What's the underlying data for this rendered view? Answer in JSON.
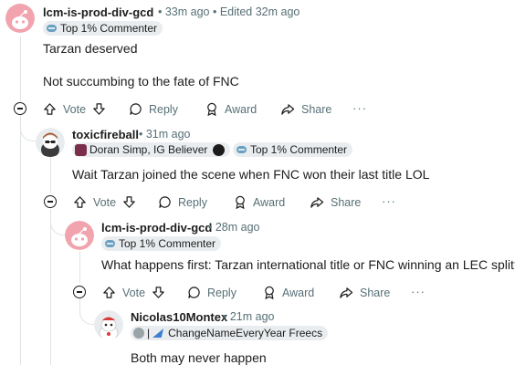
{
  "comments": [
    {
      "username": "lcm-is-prod-div-gcd",
      "meta": "• 33m ago • Edited 32m ago",
      "flair": "Top 1% Commenter",
      "body_line1": "Tarzan deserved",
      "body_line2": "Not succumbing to the fate of FNC"
    },
    {
      "username": "toxicfireball",
      "meta": "• 31m ago",
      "flair_user": "Doran Simp, IG Believer",
      "flair": "Top 1% Commenter",
      "body_line1": "Wait Tarzan joined the scene when FNC won their last title LOL"
    },
    {
      "username": "lcm-is-prod-div-gcd",
      "meta": "• 28m ago",
      "flair": "Top 1% Commenter",
      "body_line1": "What happens first: Tarzan international title or FNC winning an LEC split?"
    },
    {
      "username": "Nicolas10Montex",
      "meta": "• 21m ago",
      "flair_user": "ChangeNameEveryYear Freecs",
      "body_line1": "Both may never happen"
    }
  ],
  "actions": {
    "vote": "Vote",
    "reply": "Reply",
    "award": "Award",
    "share": "Share",
    "more": "···"
  },
  "colors": {
    "text": "#1c1c1c",
    "meta": "#576f76",
    "flair_bg": "#eaedef",
    "thread_line": "#dfe3e6",
    "avatar_pink": "#f1a3ae"
  },
  "icons": [
    "upvote-icon",
    "downvote-icon",
    "reply-bubble-icon",
    "award-icon",
    "share-icon",
    "collapse-minus-icon",
    "snoo-avatar",
    "commenter-badge-icon"
  ]
}
